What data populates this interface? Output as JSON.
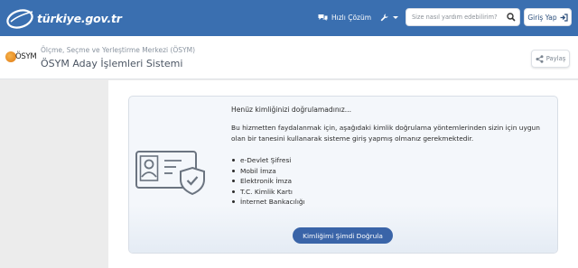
{
  "topbar": {
    "logo_text": "türkiye.gov.tr",
    "quick_solution_label": "Hızlı Çözüm",
    "search_placeholder": "Size nasıl yardım edebilirim?",
    "login_label": "Giriş Yap",
    "accent_color": "#3a6fb0"
  },
  "header": {
    "institution_logo_text": "ÖSYM",
    "organization": "Ölçme, Seçme ve Yerleştirme Merkezi (ÖSYM)",
    "system_title": "ÖSYM Aday İşlemleri Sistemi",
    "share_label": "Paylaş"
  },
  "card": {
    "not_verified_text": "Henüz kimliğinizi doğrulamadınız...",
    "description": "Bu hizmetten faydalanmak için, aşağıdaki kimlik doğrulama yöntemlerinden sizin için uygun olan bir tanesini kullanarak sisteme giriş yapmış olmanız gerekmektedir.",
    "methods": [
      "e-Devlet Şifresi",
      "Mobil İmza",
      "Elektronik İmza",
      "T.C. Kimlik Kartı",
      "İnternet Bankacılığı"
    ],
    "verify_button_label": "Kimliğimi Şimdi Doğrula",
    "icon": "id-card-shield-icon"
  }
}
